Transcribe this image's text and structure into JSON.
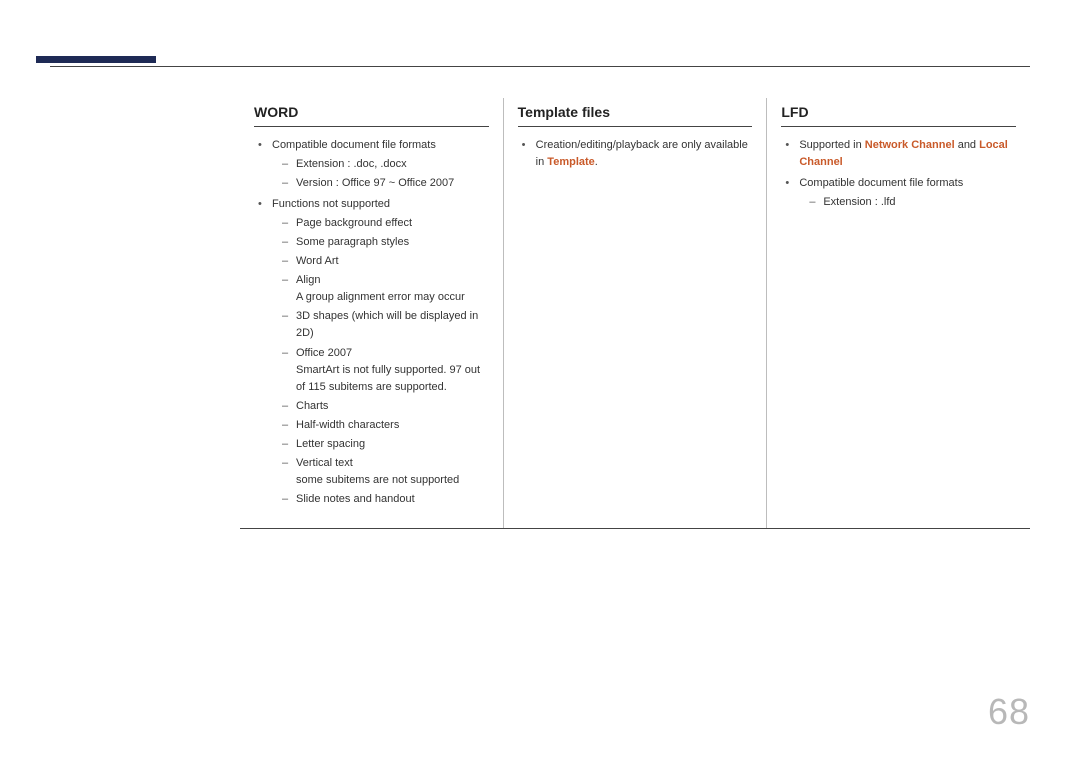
{
  "page_number": "68",
  "columns": {
    "word": {
      "heading": "WORD",
      "b1": "Compatible document file formats",
      "b1_d1": "Extension : .doc, .docx",
      "b1_d2": "Version : Office 97 ~ Office 2007",
      "b2": "Functions not supported",
      "b2_d1": "Page background effect",
      "b2_d2": "Some paragraph styles",
      "b2_d3": "Word Art",
      "b2_d4": "Align",
      "b2_d4_sub": "A group alignment error may occur",
      "b2_d5": "3D shapes (which will be displayed in 2D)",
      "b2_d6": "Office 2007",
      "b2_d6_sub": "SmartArt is not fully supported. 97 out of 115 subitems are supported.",
      "b2_d7": "Charts",
      "b2_d8": "Half-width characters",
      "b2_d9": "Letter spacing",
      "b2_d10": "Vertical text",
      "b2_d10_sub": "some subitems are not supported",
      "b2_d11": "Slide notes and handout"
    },
    "template": {
      "heading": "Template files",
      "b1_pre": "Creation/editing/playback are only available in ",
      "b1_hl": "Template",
      "b1_post": "."
    },
    "lfd": {
      "heading": "LFD",
      "b1_pre": "Supported in ",
      "b1_hl1": "Network Channel",
      "b1_mid": " and ",
      "b1_hl2": "Local Channel",
      "b2": "Compatible document file formats",
      "b2_d1": "Extension : .lfd"
    }
  }
}
